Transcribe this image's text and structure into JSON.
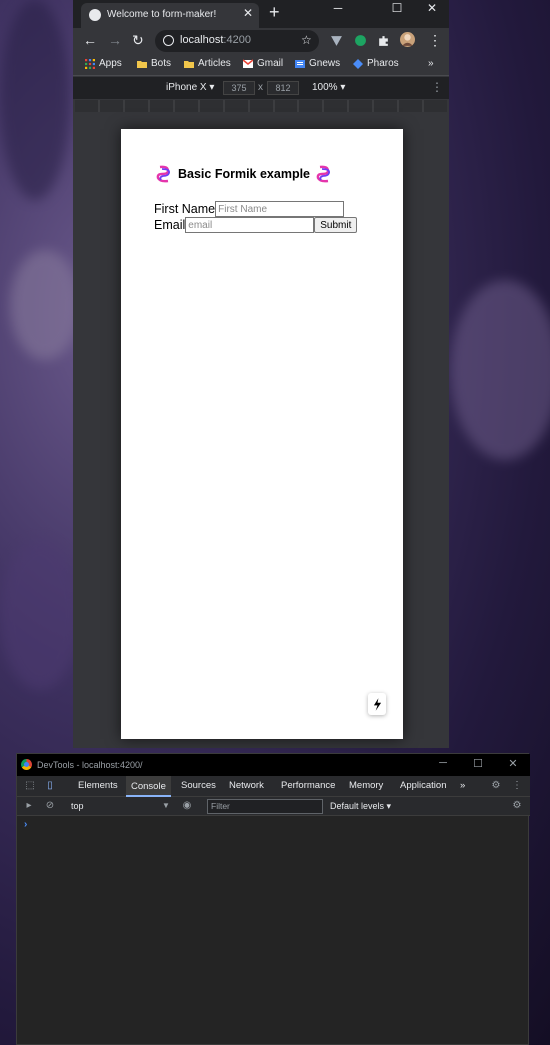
{
  "browser": {
    "tab_title": "Welcome to form-maker!",
    "url_host": "localhost",
    "url_port": ":4200",
    "bookmarks": [
      "Apps",
      "Bots",
      "Articles",
      "Gmail",
      "Gnews",
      "Pharos"
    ],
    "bookmarks_overflow": "»"
  },
  "device_toolbar": {
    "device": "iPhone X ▾",
    "width": "375",
    "separator": "x",
    "height": "812",
    "zoom": "100% ▾"
  },
  "app": {
    "title": "Basic Formik example",
    "first_name_label": "First Name",
    "first_name_placeholder": "First Name",
    "email_label": "Email",
    "email_placeholder": "email",
    "submit_label": "Submit"
  },
  "devtools": {
    "window_title": "DevTools - localhost:4200/",
    "tabs": [
      "Elements",
      "Console",
      "Sources",
      "Network",
      "Performance",
      "Memory",
      "Application"
    ],
    "active_tab": "Console",
    "overflow": "»",
    "context": "top",
    "filter_placeholder": "Filter",
    "levels": "Default levels ▾",
    "prompt": "›"
  },
  "colors": {
    "chrome_dark": "#202124",
    "chrome_toolbar": "#35363a",
    "accent_blue": "#8ab4f8",
    "logo_pink": "#e535ab",
    "logo_purple": "#6f3cf5"
  }
}
